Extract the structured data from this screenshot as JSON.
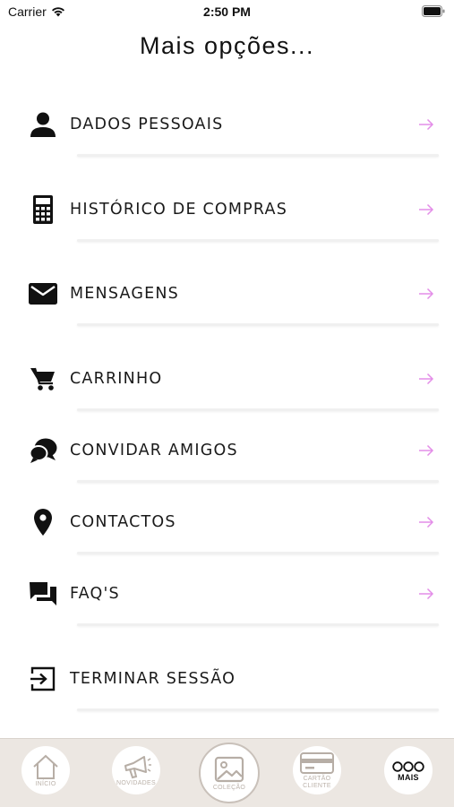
{
  "status_bar": {
    "carrier": "Carrier",
    "time": "2:50 PM"
  },
  "title": "Mais opções...",
  "colors": {
    "accent": "#e38ee8",
    "icon": "#111111",
    "tab_bg": "#ece7e2",
    "tab_muted": "#bbb2aa"
  },
  "menu": [
    {
      "label": "DADOS PESSOAIS",
      "icon": "person-icon",
      "has_arrow": true
    },
    {
      "label": "HISTÓRICO DE COMPRAS",
      "icon": "calculator-icon",
      "has_arrow": true
    },
    {
      "label": "MENSAGENS",
      "icon": "envelope-icon",
      "has_arrow": true
    },
    {
      "label": "CARRINHO",
      "icon": "cart-icon",
      "has_arrow": true
    },
    {
      "label": "CONVIDAR AMIGOS",
      "icon": "chat-bubbles-icon",
      "has_arrow": true
    },
    {
      "label": "CONTACTOS",
      "icon": "location-pin-icon",
      "has_arrow": true
    },
    {
      "label": "FAQ'S",
      "icon": "forum-icon",
      "has_arrow": true
    },
    {
      "label": "TERMINAR SESSÃO",
      "icon": "logout-icon",
      "has_arrow": false
    }
  ],
  "tabs": [
    {
      "label": "INÍCIO",
      "icon": "home-icon",
      "active": false
    },
    {
      "label": "NOVIDADES",
      "icon": "megaphone-icon",
      "active": false
    },
    {
      "label": "COLEÇÃO",
      "icon": "image-icon",
      "active": false
    },
    {
      "label": "CARTÃO CLIENTE",
      "icon": "card-icon",
      "active": false
    },
    {
      "label": "MAIS",
      "icon": "more-icon",
      "active": true
    }
  ]
}
